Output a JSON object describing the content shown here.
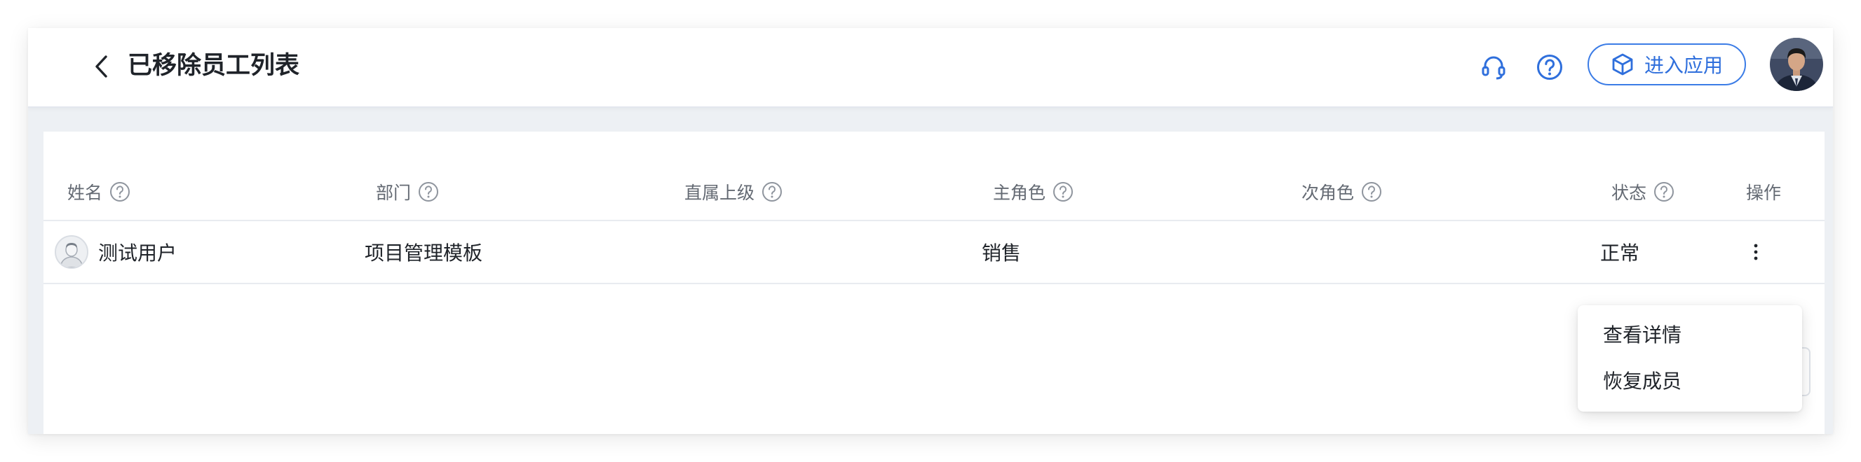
{
  "header": {
    "title": "已移除员工列表",
    "back_icon": "chevron-left-icon",
    "headset_icon": "headset-icon",
    "help_icon": "help-circle-icon",
    "enter_app_label": "进入应用",
    "enter_app_icon": "cube-icon",
    "accent_color": "#2f6fdc"
  },
  "table": {
    "columns": [
      {
        "label": "姓名",
        "has_help": true
      },
      {
        "label": "部门",
        "has_help": true
      },
      {
        "label": "直属上级",
        "has_help": true
      },
      {
        "label": "主角色",
        "has_help": true
      },
      {
        "label": "次角色",
        "has_help": true
      },
      {
        "label": "状态",
        "has_help": true
      },
      {
        "label": "操作",
        "has_help": false
      }
    ],
    "rows": [
      {
        "name": "测试用户",
        "department": "项目管理模板",
        "manager": "",
        "primary_role": "销售",
        "secondary_role": "",
        "status": "正常"
      }
    ]
  },
  "row_menu": {
    "items": [
      {
        "label": "查看详情"
      },
      {
        "label": "恢复成员"
      }
    ]
  }
}
